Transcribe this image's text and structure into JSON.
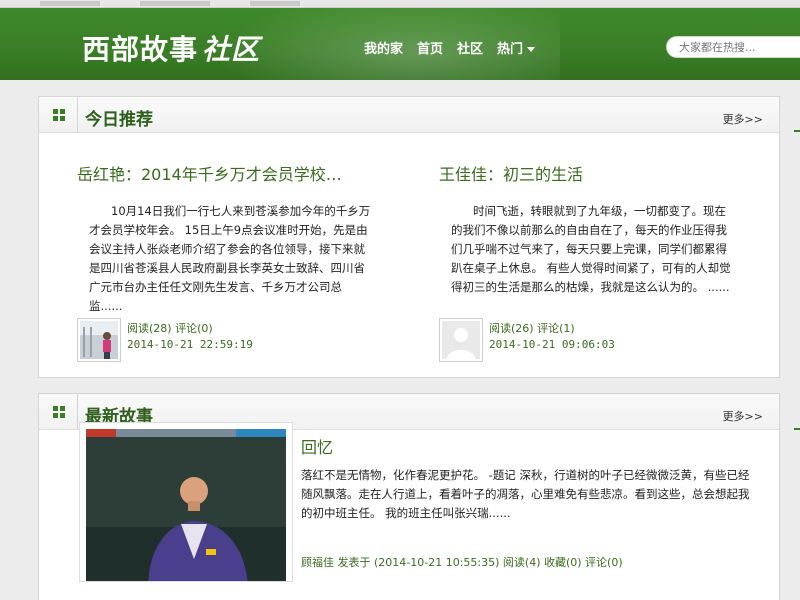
{
  "header": {
    "logo_main": "西部故事",
    "logo_italic": "社区",
    "nav": [
      "我的家",
      "首页",
      "社区",
      "热门"
    ],
    "search_placeholder": "大家都在热搜..."
  },
  "today": {
    "title": "今日推荐",
    "more": "更多>>",
    "items": [
      {
        "title": "岳红艳：2014年千乡万才会员学校…",
        "text": "10月14日我们一行七人来到苍溪参加今年的千乡万才会员学校年会。    15日上午9点会议准时开始，先是由会议主持人张焱老师介绍了参会的各位领导，接下来就是四川省苍溪县人民政府副县长李英女士致辞、四川省广元市台办主任任文刚先生发言、千乡万才公司总监......",
        "stats": "阅读(28) 评论(0)",
        "date": "2014-10-21 22:59:19"
      },
      {
        "title": "王佳佳：初三的生活",
        "text": "时间飞逝，转眼就到了九年级，一切都变了。现在的我们不像以前那么的自由自在了，每天的作业压得我们几乎喘不过气来了，每天只要上完课，同学们都累得趴在桌子上休息。 有些人觉得时间紧了，可有的人却觉得初三的生活是那么的枯燥，我就是这么认为的。 ......",
        "stats": "阅读(26) 评论(1)",
        "date": "2014-10-21 09:06:03"
      }
    ]
  },
  "latest": {
    "title": "最新故事",
    "more": "更多>>",
    "story": {
      "title": "回忆",
      "text": "落红不是无情物，化作春泥更护花。 -题记 深秋，行道树的叶子已经微微泛黄，有些已经随风飘落。走在人行道上，看着叶子的凋落，心里难免有些悲凉。看到这些，总会想起我的初中班主任。 我的班主任叫张兴瑞......",
      "meta": "顾福佳 发表于 (2014-10-21 10:55:35)  阅读(4) 收藏(0) 评论(0)"
    }
  },
  "colors": {
    "brand_green": "#3a7d27",
    "link_green": "#3a6b1e"
  }
}
